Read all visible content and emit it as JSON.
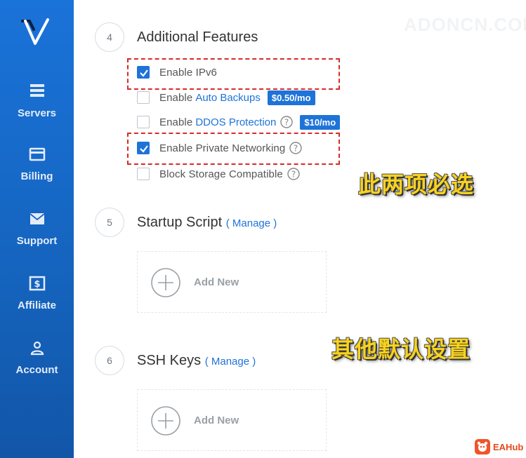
{
  "sidebar": {
    "items": [
      {
        "label": "Servers",
        "icon": "servers-icon"
      },
      {
        "label": "Billing",
        "icon": "credit-card-icon"
      },
      {
        "label": "Support",
        "icon": "envelope-icon"
      },
      {
        "label": "Affiliate",
        "icon": "dollar-icon"
      },
      {
        "label": "Account",
        "icon": "user-icon"
      }
    ]
  },
  "sections": {
    "features": {
      "number": "4",
      "title": "Additional Features",
      "options": [
        {
          "prefix": "Enable IPv6",
          "link": "",
          "checked": true
        },
        {
          "prefix": "Enable",
          "link": "Auto Backups",
          "badge": "$0.50/mo",
          "checked": false
        },
        {
          "prefix": "Enable",
          "link": "DDOS Protection",
          "badge": "$10/mo",
          "checked": false
        },
        {
          "prefix": "Enable Private Networking",
          "link": "",
          "checked": true
        },
        {
          "prefix": "Block Storage Compatible",
          "link": "",
          "checked": false
        }
      ]
    },
    "startup": {
      "number": "5",
      "title": "Startup Script",
      "manage": "( Manage )",
      "add_label": "Add New"
    },
    "ssh": {
      "number": "6",
      "title": "SSH Keys",
      "manage": "( Manage )",
      "add_label": "Add New"
    }
  },
  "annotations": {
    "required": "此两项必选",
    "defaults": "其他默认设置"
  },
  "watermark": "ADONCN.COM",
  "brand": {
    "name": "EAHub"
  },
  "colors": {
    "sidebar": "#1565c0",
    "accent": "#1e73d8",
    "highlight_box": "#d62b2b",
    "annotation": "#f7d21f"
  }
}
